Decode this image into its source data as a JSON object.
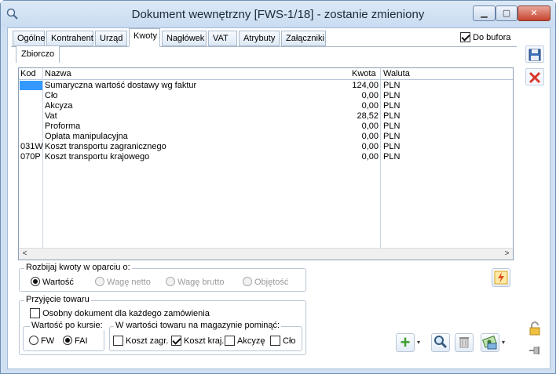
{
  "window": {
    "title": "Dokument wewnętrzny [FWS-1/18]  - zostanie zmieniony",
    "minimize_glyph": "▁",
    "maximize_glyph": "▢",
    "close_glyph": "✕"
  },
  "tabs": [
    "Ogólne",
    "Kontrahent",
    "Urząd",
    "Kwoty",
    "Nagłówek",
    "VAT",
    "Atrybuty",
    "Załączniki"
  ],
  "active_tab": "Kwoty",
  "do_bufora": {
    "label": "Do bufora",
    "checked": true
  },
  "subtab": "Zbiorczo",
  "grid": {
    "columns": {
      "kod": "Kod",
      "nazwa": "Nazwa",
      "kwota": "Kwota",
      "waluta": "Waluta"
    },
    "rows": [
      {
        "kod": "",
        "nazwa": "Sumaryczna wartość dostawy wg faktur",
        "kwota": "124,00",
        "waluta": "PLN"
      },
      {
        "kod": "",
        "nazwa": "Cło",
        "kwota": "0,00",
        "waluta": "PLN"
      },
      {
        "kod": "",
        "nazwa": "Akcyza",
        "kwota": "0,00",
        "waluta": "PLN"
      },
      {
        "kod": "",
        "nazwa": "Vat",
        "kwota": "28,52",
        "waluta": "PLN"
      },
      {
        "kod": "",
        "nazwa": "Proforma",
        "kwota": "0,00",
        "waluta": "PLN"
      },
      {
        "kod": "",
        "nazwa": "Opłata manipulacyjna",
        "kwota": "0,00",
        "waluta": "PLN"
      },
      {
        "kod": "031W",
        "nazwa": "Koszt transportu zagranicznego",
        "kwota": "0,00",
        "waluta": "PLN"
      },
      {
        "kod": "070P",
        "nazwa": "Koszt transportu krajowego",
        "kwota": "0,00",
        "waluta": "PLN"
      }
    ],
    "scroll_left": "<",
    "scroll_right": ">"
  },
  "rozbijaj": {
    "legend": "Rozbijaj kwoty w oparciu o:",
    "options": [
      {
        "label": "Wartość",
        "selected": true,
        "enabled": true
      },
      {
        "label": "Wagę netto",
        "selected": false,
        "enabled": false
      },
      {
        "label": "Wagę brutto",
        "selected": false,
        "enabled": false
      },
      {
        "label": "Objętość",
        "selected": false,
        "enabled": false
      }
    ]
  },
  "przyjecie": {
    "legend": "Przyjęcie towaru",
    "osobny_label": "Osobny dokument dla każdego zamówienia",
    "osobny_checked": false
  },
  "wartosc_po_kursie": {
    "legend": "Wartość po kursie:",
    "options": [
      {
        "label": "FW",
        "selected": false
      },
      {
        "label": "FAI",
        "selected": true
      }
    ]
  },
  "pomin": {
    "legend": "W wartości towaru na magazynie pominąć:",
    "options": [
      {
        "label": "Koszt zagr.",
        "checked": false
      },
      {
        "label": "Koszt kraj.",
        "checked": true
      },
      {
        "label": "Akcyzę",
        "checked": false
      },
      {
        "label": "Cło",
        "checked": false
      }
    ]
  },
  "toolbar": {
    "add_glyph": "+",
    "dropdown_glyph": "▾"
  },
  "colors": {
    "accent": "#3399ff",
    "add_green": "#3a9e2a",
    "delete_red": "#d9362b"
  }
}
